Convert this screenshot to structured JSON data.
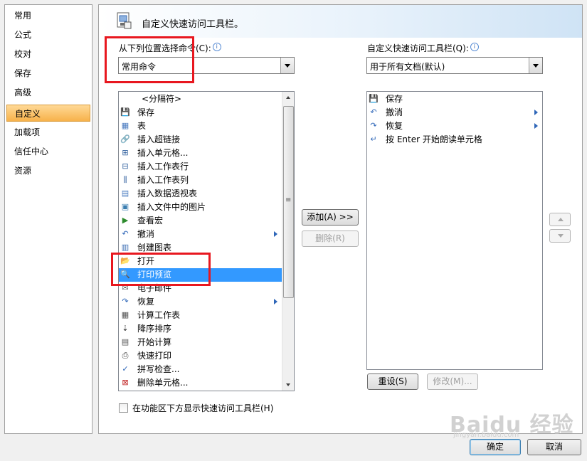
{
  "nav": {
    "items": [
      {
        "label": "常用",
        "selected": false
      },
      {
        "label": "公式",
        "selected": false
      },
      {
        "label": "校对",
        "selected": false
      },
      {
        "label": "保存",
        "selected": false
      },
      {
        "label": "高级",
        "selected": false
      },
      {
        "label": "自定义",
        "selected": true
      },
      {
        "label": "加载项",
        "selected": false
      },
      {
        "label": "信任中心",
        "selected": false
      },
      {
        "label": "资源",
        "selected": false
      }
    ]
  },
  "header": {
    "title": "自定义快速访问工具栏。",
    "icon": "quick-access-toolbar-icon"
  },
  "left_panel": {
    "label": "从下列位置选择命令(C):",
    "combo_value": "常用命令",
    "commands": [
      {
        "label": "<分隔符>",
        "icon": ""
      },
      {
        "label": "保存",
        "icon": "save-icon"
      },
      {
        "label": "表",
        "icon": "table-icon"
      },
      {
        "label": "插入超链接",
        "icon": "hyperlink-icon"
      },
      {
        "label": "插入单元格...",
        "icon": "insert-cells-icon"
      },
      {
        "label": "插入工作表行",
        "icon": "insert-row-icon"
      },
      {
        "label": "插入工作表列",
        "icon": "insert-column-icon"
      },
      {
        "label": "插入数据透视表",
        "icon": "pivot-table-icon"
      },
      {
        "label": "插入文件中的图片",
        "icon": "picture-icon"
      },
      {
        "label": "查看宏",
        "icon": "macro-icon"
      },
      {
        "label": "撤消",
        "icon": "undo-icon",
        "submenu": true
      },
      {
        "label": "创建图表",
        "icon": "chart-icon"
      },
      {
        "label": "打开",
        "icon": "open-folder-icon"
      },
      {
        "label": "打印预览",
        "icon": "print-preview-icon",
        "selected": true
      },
      {
        "label": "电子邮件",
        "icon": "email-icon"
      },
      {
        "label": "恢复",
        "icon": "redo-icon",
        "submenu": true
      },
      {
        "label": "计算工作表",
        "icon": "calculate-sheet-icon"
      },
      {
        "label": "降序排序",
        "icon": "sort-descending-icon"
      },
      {
        "label": "开始计算",
        "icon": "calculate-now-icon"
      },
      {
        "label": "快速打印",
        "icon": "quick-print-icon"
      },
      {
        "label": "拼写检查...",
        "icon": "spelling-icon"
      },
      {
        "label": "删除单元格...",
        "icon": "delete-cells-icon"
      }
    ]
  },
  "right_panel": {
    "label": "自定义快速访问工具栏(Q):",
    "combo_value": "用于所有文档(默认)",
    "items": [
      {
        "label": "保存",
        "icon": "save-icon"
      },
      {
        "label": "撤消",
        "icon": "undo-icon",
        "submenu": true
      },
      {
        "label": "恢复",
        "icon": "redo-icon",
        "submenu": true
      },
      {
        "label": "按 Enter 开始朗读单元格",
        "icon": "speak-on-enter-icon"
      }
    ]
  },
  "buttons": {
    "add": "添加(A) >>",
    "remove": "删除(R)",
    "reset": "重设(S)",
    "modify": "修改(M)...",
    "ok": "确定",
    "cancel": "取消"
  },
  "checkbox": {
    "label": "在功能区下方显示快速访问工具栏(H)",
    "checked": false
  },
  "watermark": {
    "brand": "Baidu 经验",
    "url": "jingyan.baidu.com"
  },
  "colors": {
    "selection": "#3399ff",
    "highlight": "#e8171f",
    "nav_selected": "#f7b24b"
  }
}
